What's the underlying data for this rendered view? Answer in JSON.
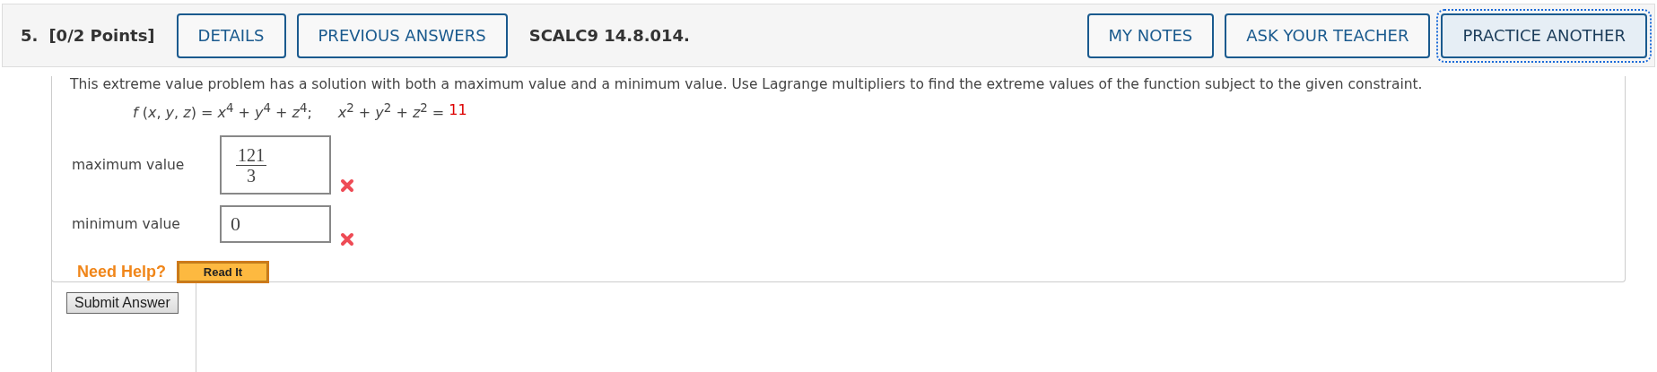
{
  "question": {
    "number": "5.",
    "points": "[0/2 Points]",
    "code": "SCALC9 14.8.014."
  },
  "left_buttons": [
    {
      "label": "DETAILS",
      "focused": false
    },
    {
      "label": "PREVIOUS ANSWERS",
      "focused": false
    }
  ],
  "right_buttons": [
    {
      "label": "MY NOTES",
      "focused": false
    },
    {
      "label": "ASK YOUR TEACHER",
      "focused": false
    },
    {
      "label": "PRACTICE ANOTHER",
      "focused": true
    }
  ],
  "problem_text": "This extreme value problem has a solution with both a maximum value and a minimum value. Use Lagrange multipliers to find the extreme values of the function subject to the given constraint.",
  "formula": {
    "function": "*f* (*x*, *y*, *z*) = *x*$^{4}$ + *y*$^{4}$ + *z*$^{4}$;",
    "constraint": "*x*$^{2}$ + *y*$^{2}$ + *z*$^{2}$ =",
    "constraint_value": "11"
  },
  "answers": [
    {
      "label": "maximum value",
      "kind": "fraction",
      "numerator": "121",
      "denominator": "3",
      "correct": false
    },
    {
      "label": "minimum value",
      "kind": "plain",
      "value": "0",
      "correct": false
    }
  ],
  "help": {
    "label": "Need Help?",
    "button": "Read It"
  },
  "submit_button": "Submit Answer"
}
